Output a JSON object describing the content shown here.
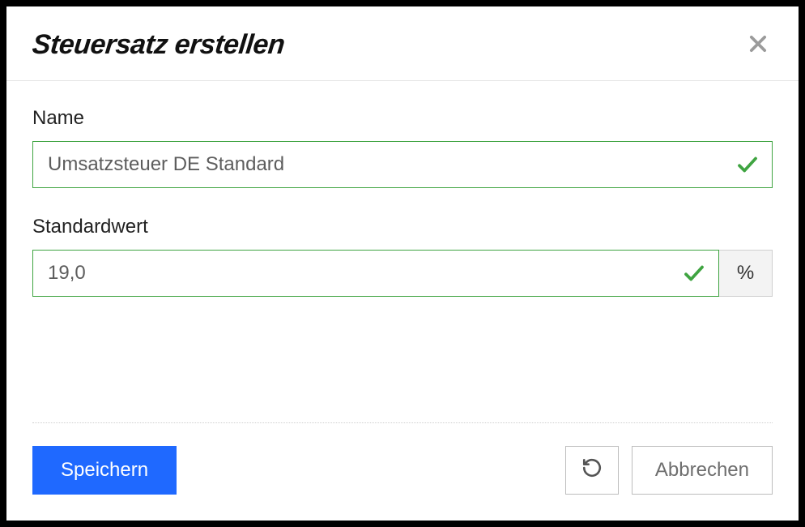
{
  "modal": {
    "title": "Steuersatz erstellen"
  },
  "fields": {
    "name": {
      "label": "Name",
      "value": "Umsatzsteuer DE Standard"
    },
    "default_value": {
      "label": "Standardwert",
      "value": "19,0",
      "unit": "%"
    }
  },
  "actions": {
    "save": "Speichern",
    "cancel": "Abbrechen"
  }
}
